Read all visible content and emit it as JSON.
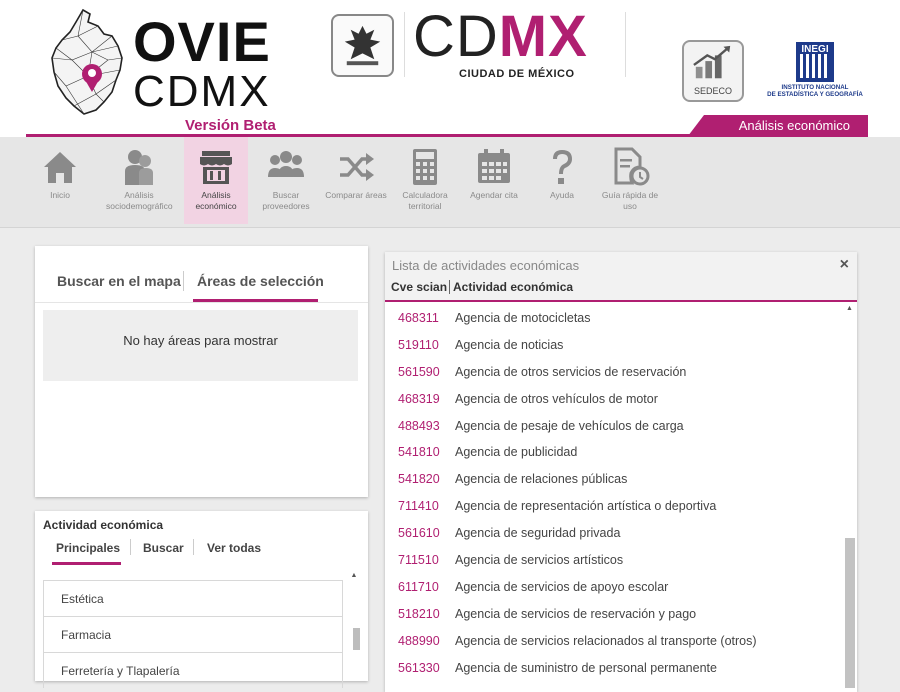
{
  "header": {
    "ovie_title": "OVIE",
    "ovie_subtitle": "CDMX",
    "version": "Versión Beta",
    "cdmx_logo_a": "CD",
    "cdmx_logo_b": "MX",
    "cdmx_subtitle": "CIUDAD DE MÉXICO",
    "sedeco_label": "SEDECO",
    "inegi_logo": "INEGI",
    "inegi_caption_line1": "INSTITUTO NACIONAL",
    "inegi_caption_line2": "DE ESTADÍSTICA Y GEOGRAFÍA",
    "section_tag": "Análisis económico",
    "accent_color": "#b01f71"
  },
  "nav": {
    "items": [
      {
        "label": "Inicio",
        "icon": "home-icon"
      },
      {
        "label": "Análisis sociodemográfico",
        "icon": "people-profile-icon"
      },
      {
        "label": "Análisis económico",
        "icon": "store-icon",
        "active": true
      },
      {
        "label": "Buscar proveedores",
        "icon": "group-icon"
      },
      {
        "label": "Comparar áreas",
        "icon": "shuffle-icon"
      },
      {
        "label": "Calculadora territorial",
        "icon": "calculator-icon"
      },
      {
        "label": "Agendar cita",
        "icon": "calendar-icon"
      },
      {
        "label": "Ayuda",
        "icon": "question-icon"
      },
      {
        "label": "Guía rápida de uso",
        "icon": "document-clock-icon"
      }
    ]
  },
  "areas_panel": {
    "tab_map": "Buscar en el mapa",
    "tab_areas": "Áreas de selección",
    "active_tab": "Áreas de selección",
    "empty_message": "No hay áreas para mostrar"
  },
  "activity_panel": {
    "title": "Actividad económica",
    "tabs": [
      "Principales",
      "Buscar",
      "Ver todas"
    ],
    "active_tab": "Principales",
    "items": [
      "Estética",
      "Farmacia",
      "Ferretería y Tlapalería"
    ]
  },
  "list_panel": {
    "title": "Lista de actividades económicas",
    "close_label": "×",
    "col_code": "Cve scian",
    "col_name": "Actividad económica",
    "rows": [
      {
        "code": "468311",
        "name": "Agencia de motocicletas"
      },
      {
        "code": "519110",
        "name": "Agencia de noticias"
      },
      {
        "code": "561590",
        "name": "Agencia de otros servicios de reservación"
      },
      {
        "code": "468319",
        "name": "Agencia de otros vehículos de motor"
      },
      {
        "code": "488493",
        "name": "Agencia de pesaje de vehículos de carga"
      },
      {
        "code": "541810",
        "name": "Agencia de publicidad"
      },
      {
        "code": "541820",
        "name": "Agencia de relaciones públicas"
      },
      {
        "code": "711410",
        "name": "Agencia de representación artística o deportiva"
      },
      {
        "code": "561610",
        "name": "Agencia de seguridad privada"
      },
      {
        "code": "711510",
        "name": "Agencia de servicios artísticos"
      },
      {
        "code": "611710",
        "name": "Agencia de servicios de apoyo escolar"
      },
      {
        "code": "518210",
        "name": "Agencia de servicios de reservación y pago"
      },
      {
        "code": "488990",
        "name": "Agencia de servicios relacionados al transporte (otros)"
      },
      {
        "code": "561330",
        "name": "Agencia de suministro de personal permanente"
      }
    ]
  }
}
